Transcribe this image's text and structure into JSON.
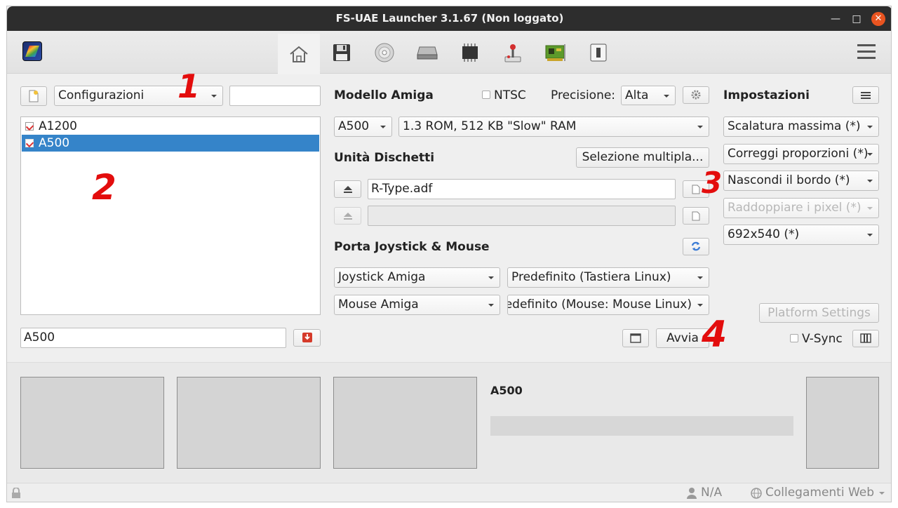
{
  "window": {
    "title": "FS-UAE Launcher 3.1.67 (Non loggato)"
  },
  "toolbar": {
    "tabs": [
      {
        "icon": "home-icon"
      },
      {
        "icon": "floppy-disk-icon"
      },
      {
        "icon": "cdrom-icon"
      },
      {
        "icon": "hard-drive-icon"
      },
      {
        "icon": "memory-chip-icon"
      },
      {
        "icon": "joystick-icon"
      },
      {
        "icon": "expansion-card-icon"
      },
      {
        "icon": "switch-icon"
      }
    ]
  },
  "configs": {
    "dropdown": "Configurazioni",
    "search_value": "",
    "items": [
      "A1200",
      "A500"
    ],
    "selected": "A500",
    "name_value": "A500"
  },
  "amiga": {
    "heading": "Modello Amiga",
    "ntsc_label": "NTSC",
    "precision_label": "Precisione:",
    "precision_value": "Alta",
    "model": "A500",
    "model_detail": "1.3 ROM, 512 KB \"Slow\" RAM"
  },
  "floppy": {
    "heading": "Unità Dischetti",
    "multi_select": "Selezione multipla...",
    "drive0": "R-Type.adf",
    "drive1": ""
  },
  "ports": {
    "heading": "Porta Joystick & Mouse",
    "port1_type": "Joystick Amiga",
    "port1_device": "Predefinito (Tastiera Linux)",
    "port0_type": "Mouse Amiga",
    "port0_device": "Predefinito (Mouse: Mouse Linux)"
  },
  "launch": {
    "start": "Avvia",
    "vsync_label": "V-Sync"
  },
  "settings": {
    "heading": "Impostazioni",
    "scaling": "Scalatura massima (*)",
    "aspect": "Correggi proporzioni (*)",
    "border": "Nascondi il bordo (*)",
    "pixel_double": "Raddoppiare i pixel (*)",
    "resolution": "692x540 (*)",
    "platform": "Platform Settings"
  },
  "game_info": {
    "title": "A500"
  },
  "status": {
    "user": "N/A",
    "links": "Collegamenti Web"
  },
  "annotations": [
    "1",
    "2",
    "3",
    "4"
  ],
  "colors": {
    "selection": "#3584c9",
    "close": "#e95420",
    "annotation": "#e30d0d"
  }
}
